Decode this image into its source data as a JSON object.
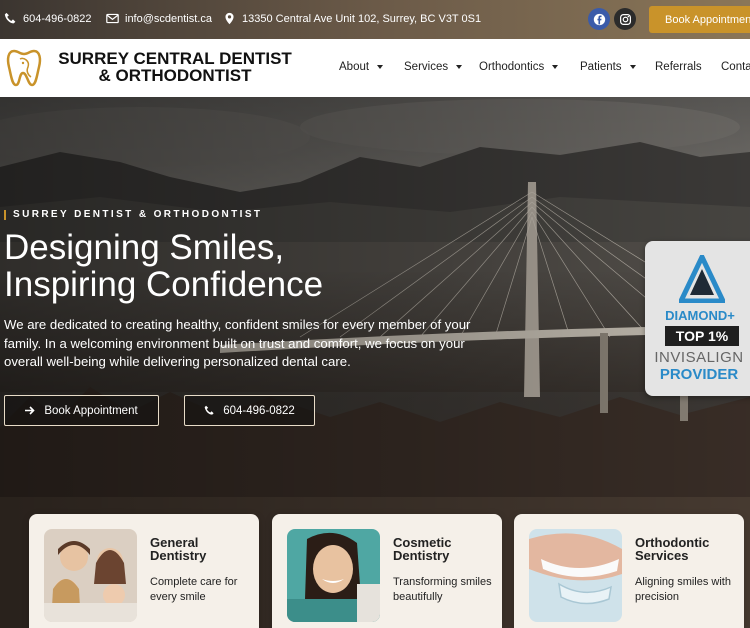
{
  "topbar": {
    "phone": "604-496-0822",
    "email": "info@scdentist.ca",
    "address": "13350 Central Ave Unit 102, Surrey, BC V3T 0S1",
    "book_label": "Book Appointment",
    "icons": [
      "phone-icon",
      "mail-icon",
      "location-pin-icon",
      "facebook-icon",
      "instagram-icon"
    ]
  },
  "header": {
    "logo_line1": "SURREY CENTRAL DENTIST",
    "logo_line2": "& ORTHODONTIST",
    "nav": [
      {
        "label": "About",
        "dropdown": true
      },
      {
        "label": "Services",
        "dropdown": true
      },
      {
        "label": "Orthodontics",
        "dropdown": true
      },
      {
        "label": "Patients",
        "dropdown": true
      },
      {
        "label": "Referrals",
        "dropdown": false
      },
      {
        "label": "Contact",
        "dropdown": false
      }
    ]
  },
  "hero": {
    "eyebrow": "SURREY DENTIST & ORTHODONTIST",
    "headline_line1": "Designing Smiles,",
    "headline_line2": "Inspiring Confidence",
    "lead": "We are dedicated to creating healthy, confident smiles for every member of your family. In a welcoming environment built on trust and comfort, we focus on your overall well-being while delivering personalized dental care.",
    "btn_book": "Book Appointment",
    "btn_phone": "604-496-0822"
  },
  "badge": {
    "line1": "DIAMOND+",
    "line2": "TOP 1%",
    "line3": "INVISALIGN",
    "line4": "PROVIDER"
  },
  "cards": [
    {
      "title_line1": "General",
      "title_line2": "Dentistry",
      "desc": "Complete care for every smile"
    },
    {
      "title_line1": "Cosmetic",
      "title_line2": "Dentistry",
      "desc": "Transforming smiles beautifully"
    },
    {
      "title_line1": "Orthodontic",
      "title_line2": "Services",
      "desc": "Aligning smiles with precision"
    }
  ],
  "colors": {
    "accent_gold": "#c9932a",
    "invisalign_blue": "#2a8ac8",
    "facebook_blue": "#3b5ba9"
  }
}
